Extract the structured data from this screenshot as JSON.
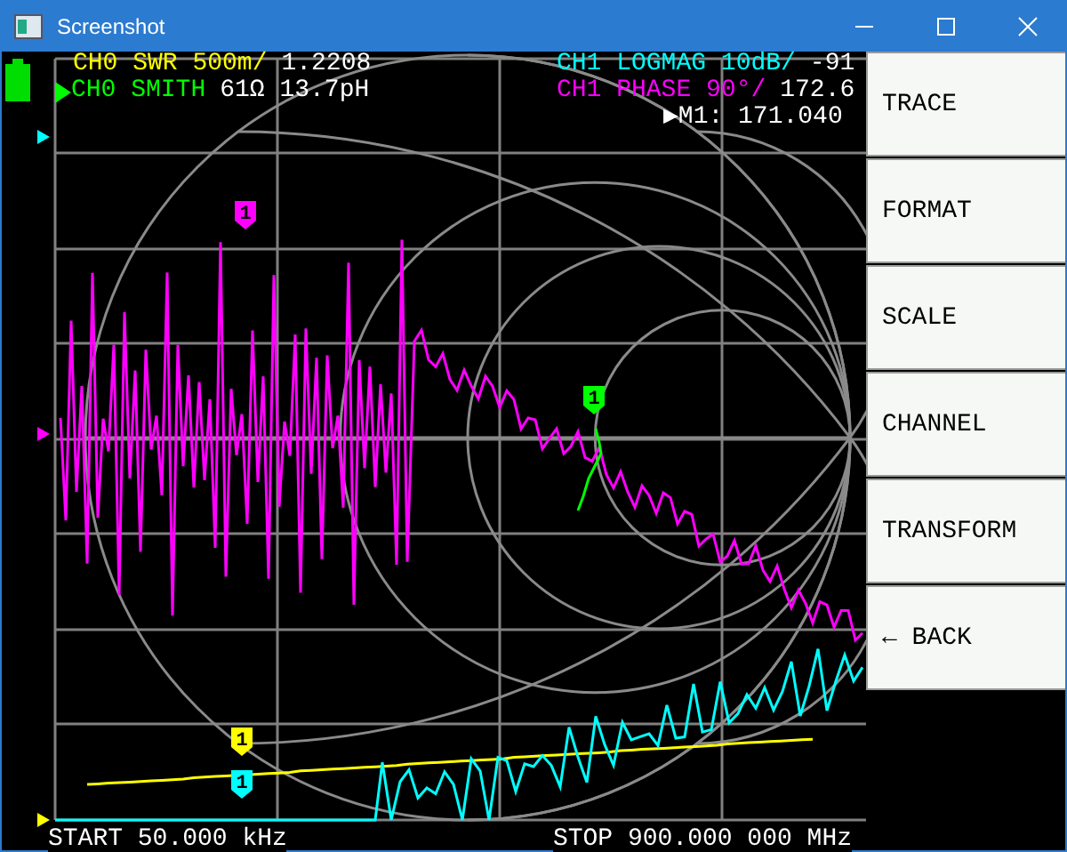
{
  "window": {
    "title": "Screenshot"
  },
  "traces_left": [
    {
      "label": "CH0 SWR 500m/",
      "value": "1.2208",
      "color": "#ffff00",
      "selected": false
    },
    {
      "label": "CH0 SMITH",
      "value": "61Ω 13.7pH",
      "color": "#00ff00",
      "selected": true
    }
  ],
  "traces_right": [
    {
      "label": "CH1 LOGMAG 10dB/",
      "value": "-91",
      "color": "#00ffff"
    },
    {
      "label": "CH1 PHASE 90°/",
      "value": "172.6",
      "color": "#ff00ff"
    }
  ],
  "marker_readout": "▶M1: 171.040",
  "markers": [
    {
      "label": "1",
      "color": "#ff00ff"
    },
    {
      "label": "1",
      "color": "#00ff00"
    },
    {
      "label": "1",
      "color": "#ffff00"
    },
    {
      "label": "1",
      "color": "#00ffff"
    }
  ],
  "menu": [
    {
      "label": "TRACE"
    },
    {
      "label": "FORMAT"
    },
    {
      "label": "SCALE"
    },
    {
      "label": "CHANNEL"
    },
    {
      "label": "TRANSFORM"
    },
    {
      "label": "← BACK"
    }
  ],
  "sweep": {
    "start": "START 50.000 kHz",
    "stop": "STOP 900.000 000 MHz"
  }
}
